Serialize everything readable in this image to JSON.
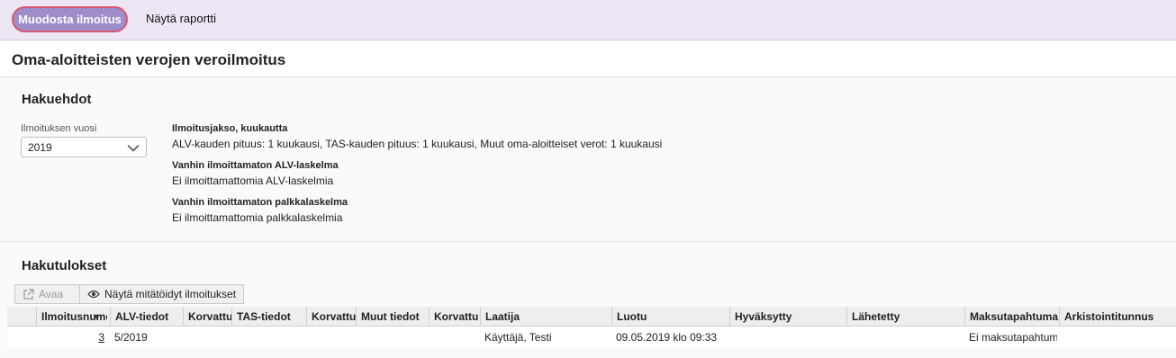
{
  "toolbar": {
    "create_label": "Muodosta ilmoitus",
    "report_label": "Näytä raportti"
  },
  "page": {
    "title": "Oma-aloitteisten verojen veroilmoitus"
  },
  "criteria": {
    "title": "Hakuehdot",
    "year_label": "Ilmoituksen vuosi",
    "year_value": "2019",
    "period_label": "Ilmoitusjakso, kuukautta",
    "period_value": "ALV-kauden pituus: 1 kuukausi, TAS-kauden pituus: 1 kuukausi, Muut oma-aloitteiset verot: 1 kuukausi",
    "vat_label": "Vanhin ilmoittamaton ALV-laskelma",
    "vat_value": "Ei ilmoittamattomia ALV-laskelmia",
    "payroll_label": "Vanhin ilmoittamaton palkkalaskelma",
    "payroll_value": "Ei ilmoittamattomia palkkalaskelmia"
  },
  "results": {
    "title": "Hakutulokset",
    "open_label": "Avaa",
    "show_void_label": "Näytä mitätöidyt ilmoitukset",
    "columns": [
      "Ilmoitusnumero",
      "ALV-tiedot",
      "Korvattu",
      "TAS-tiedot",
      "Korvattu",
      "Muut tiedot",
      "Korvattu",
      "Laatija",
      "Luotu",
      "Hyväksytty",
      "Lähetetty",
      "Maksutapahtuma",
      "Arkistointitunnus"
    ],
    "rows": [
      {
        "number": "3",
        "alv": "5/2019",
        "author": "Käyttäjä, Testi",
        "created": "09.05.2019 klo 09:33",
        "payment": "Ei maksutapahtumaa"
      }
    ]
  }
}
